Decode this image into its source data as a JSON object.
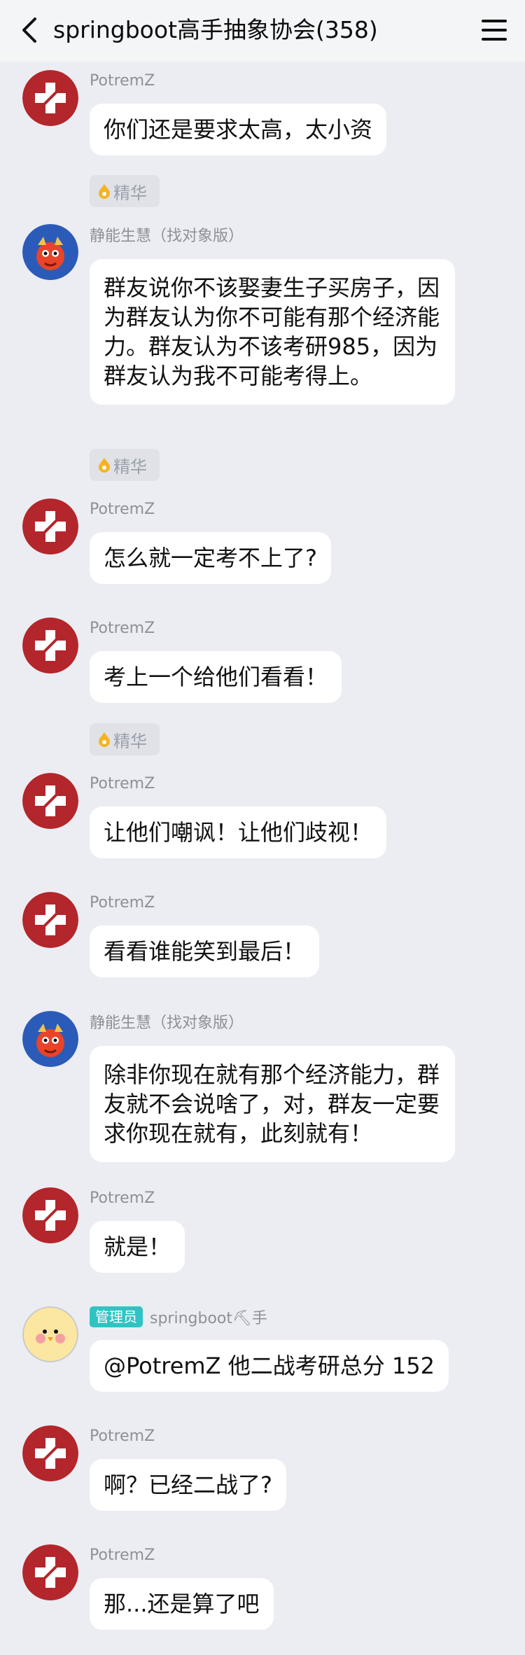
{
  "header": {
    "title": "springboot高手抽象协会(358)"
  },
  "essence_label": "精华",
  "messages": [
    {
      "sender": "PotremZ",
      "text": "你们还是要求太高，太小资"
    },
    {
      "sender": "静能生慧（找对象版）",
      "text": "群友说你不该娶妻生子买房子，因为群友认为你不可能有那个经济能力。群友认为不该考研985，因为群友认为我不可能考得上。"
    },
    {
      "sender": "PotremZ",
      "text": "怎么就一定考不上了?"
    },
    {
      "sender": "PotremZ",
      "text": "考上一个给他们看看！"
    },
    {
      "sender": "PotremZ",
      "text": "让他们嘲讽！让他们歧视！"
    },
    {
      "sender": "PotremZ",
      "text": "看看谁能笑到最后！"
    },
    {
      "sender": "静能生慧（找对象版）",
      "text": "除非你现在就有那个经济能力，群友就不会说啥了，对，群友一定要求你现在就有，此刻就有！"
    },
    {
      "sender": "PotremZ",
      "text": "就是！"
    },
    {
      "sender": "springboot⛏手",
      "role": "管理员",
      "text": "@PotremZ 他二战考研总分 152"
    },
    {
      "sender": "PotremZ",
      "text": "啊？已经二战了?"
    },
    {
      "sender": "PotremZ",
      "text": "那...还是算了吧"
    }
  ],
  "colors": {
    "background": "#ebedf2",
    "bubble": "#ffffff",
    "admin_badge": "#31c3c4",
    "nickname": "#8d9098",
    "red_avatar": "#b3262b"
  }
}
